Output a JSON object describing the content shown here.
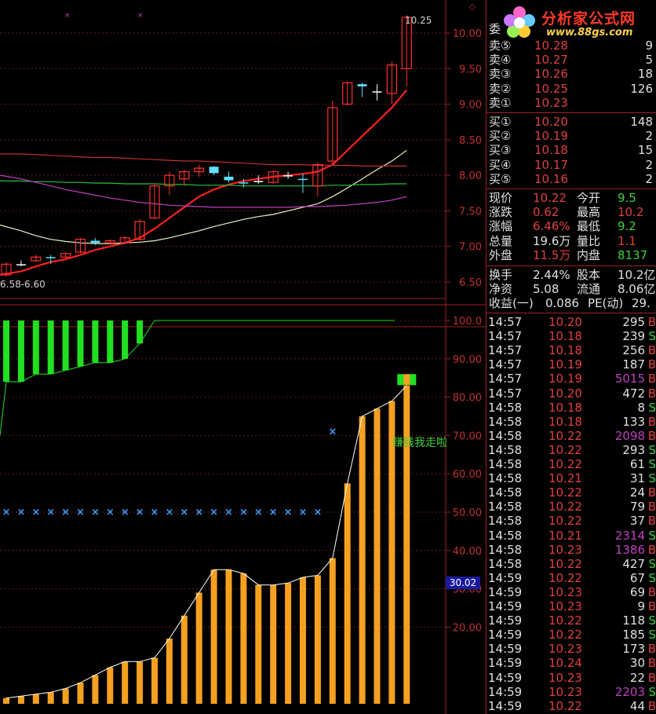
{
  "chart_data": [
    {
      "type": "candlestick",
      "title": "",
      "ylim": [
        6.5,
        10.25
      ],
      "y_ticks": [
        6.5,
        7.0,
        7.5,
        8.0,
        8.5,
        9.0,
        9.5,
        10.0
      ],
      "last_price_label": "10.25",
      "range_label": "6.58-6.60",
      "candles": [
        {
          "o": 6.6,
          "c": 6.75,
          "h": 6.78,
          "l": 6.58,
          "color": "red"
        },
        {
          "o": 6.75,
          "c": 6.75,
          "h": 6.8,
          "l": 6.72,
          "color": "white"
        },
        {
          "o": 6.8,
          "c": 6.85,
          "h": 6.88,
          "l": 6.78,
          "color": "red"
        },
        {
          "o": 6.85,
          "c": 6.85,
          "h": 6.88,
          "l": 6.75,
          "color": "cyan"
        },
        {
          "o": 6.85,
          "c": 6.9,
          "h": 6.92,
          "l": 6.83,
          "color": "red"
        },
        {
          "o": 6.92,
          "c": 7.1,
          "h": 7.12,
          "l": 6.9,
          "color": "red"
        },
        {
          "o": 7.08,
          "c": 7.05,
          "h": 7.12,
          "l": 7.02,
          "color": "cyan"
        },
        {
          "o": 7.05,
          "c": 7.08,
          "h": 7.1,
          "l": 7.02,
          "color": "red"
        },
        {
          "o": 7.05,
          "c": 7.12,
          "h": 7.15,
          "l": 7.03,
          "color": "red"
        },
        {
          "o": 7.1,
          "c": 7.35,
          "h": 7.38,
          "l": 7.08,
          "color": "red"
        },
        {
          "o": 7.4,
          "c": 7.85,
          "h": 7.88,
          "l": 7.38,
          "color": "red"
        },
        {
          "o": 7.85,
          "c": 8.0,
          "h": 8.05,
          "l": 7.72,
          "color": "red"
        },
        {
          "o": 7.95,
          "c": 8.05,
          "h": 8.08,
          "l": 7.85,
          "color": "red"
        },
        {
          "o": 8.05,
          "c": 8.1,
          "h": 8.15,
          "l": 7.98,
          "color": "red"
        },
        {
          "o": 8.12,
          "c": 8.03,
          "h": 8.13,
          "l": 8.0,
          "color": "cyan"
        },
        {
          "o": 7.98,
          "c": 7.93,
          "h": 8.05,
          "l": 7.9,
          "color": "cyan"
        },
        {
          "o": 7.9,
          "c": 7.9,
          "h": 7.95,
          "l": 7.83,
          "color": "cyan"
        },
        {
          "o": 7.92,
          "c": 7.92,
          "h": 8.0,
          "l": 7.88,
          "color": "white"
        },
        {
          "o": 7.9,
          "c": 8.05,
          "h": 8.07,
          "l": 7.88,
          "color": "red"
        },
        {
          "o": 8.0,
          "c": 8.0,
          "h": 8.05,
          "l": 7.95,
          "color": "white"
        },
        {
          "o": 7.95,
          "c": 7.95,
          "h": 8.02,
          "l": 7.75,
          "color": "cyan"
        },
        {
          "o": 7.85,
          "c": 8.15,
          "h": 8.18,
          "l": 7.7,
          "color": "red"
        },
        {
          "o": 8.2,
          "c": 8.95,
          "h": 9.05,
          "l": 8.15,
          "color": "red"
        },
        {
          "o": 9.0,
          "c": 9.3,
          "h": 9.32,
          "l": 8.98,
          "color": "red"
        },
        {
          "o": 9.28,
          "c": 9.25,
          "h": 9.3,
          "l": 9.1,
          "color": "cyan"
        },
        {
          "o": 9.18,
          "c": 9.18,
          "h": 9.28,
          "l": 9.05,
          "color": "white"
        },
        {
          "o": 9.15,
          "c": 9.55,
          "h": 9.6,
          "l": 9.0,
          "color": "red"
        },
        {
          "o": 9.5,
          "c": 10.22,
          "h": 10.25,
          "l": 9.25,
          "color": "red"
        }
      ],
      "ma_series": [
        {
          "color": "#ff2020",
          "values": [
            6.6,
            6.65,
            6.72,
            6.78,
            6.82,
            6.88,
            6.95,
            7.0,
            7.05,
            7.12,
            7.25,
            7.4,
            7.55,
            7.7,
            7.8,
            7.87,
            7.92,
            7.95,
            7.98,
            8.0,
            8.02,
            8.05,
            8.15,
            8.35,
            8.55,
            8.75,
            8.95,
            9.2
          ]
        },
        {
          "color": "#f0f0c0",
          "values": [
            7.3,
            7.22,
            7.15,
            7.1,
            7.07,
            7.05,
            7.04,
            7.04,
            7.05,
            7.06,
            7.08,
            7.12,
            7.17,
            7.22,
            7.28,
            7.33,
            7.38,
            7.42,
            7.45,
            7.5,
            7.55,
            7.6,
            7.7,
            7.82,
            7.95,
            8.08,
            8.2,
            8.35
          ]
        },
        {
          "color": "#20c040",
          "values": [
            7.92,
            7.92,
            7.91,
            7.91,
            7.9,
            7.9,
            7.89,
            7.89,
            7.88,
            7.88,
            7.88,
            7.87,
            7.87,
            7.86,
            7.86,
            7.86,
            7.85,
            7.85,
            7.85,
            7.85,
            7.85,
            7.85,
            7.86,
            7.86,
            7.87,
            7.87,
            7.88,
            7.88
          ]
        },
        {
          "color": "#c040c0",
          "values": [
            8.0,
            7.95,
            7.9,
            7.85,
            7.8,
            7.76,
            7.72,
            7.68,
            7.65,
            7.62,
            7.6,
            7.58,
            7.57,
            7.56,
            7.55,
            7.55,
            7.55,
            7.55,
            7.55,
            7.55,
            7.56,
            7.56,
            7.57,
            7.58,
            7.6,
            7.62,
            7.65,
            7.7
          ]
        },
        {
          "color": "#c03030",
          "values": [
            8.3,
            8.3,
            8.29,
            8.28,
            8.27,
            8.26,
            8.25,
            8.25,
            8.24,
            8.23,
            8.22,
            8.21,
            8.2,
            8.2,
            8.19,
            8.18,
            8.17,
            8.16,
            8.15,
            8.15,
            8.15,
            8.14,
            8.14,
            8.14,
            8.13,
            8.13,
            8.13,
            8.13
          ]
        }
      ]
    },
    {
      "type": "bar",
      "title": "",
      "ylim": [
        0,
        105
      ],
      "y_ticks": [
        20.0,
        30.0,
        40.0,
        50.0,
        60.0,
        70.0,
        80.0,
        90.0,
        100.0
      ],
      "current_value_label": "30.02",
      "annotation": "赚钱我走啦",
      "values": [
        1.5,
        2,
        2.5,
        3,
        4,
        5.5,
        7.5,
        9.5,
        11,
        11,
        12,
        17,
        23,
        29,
        35,
        35,
        34,
        31,
        31,
        31.5,
        33,
        33.5,
        38,
        57.5,
        75,
        77,
        79,
        83
      ],
      "green_bars_top": [
        100,
        100,
        100,
        100,
        100,
        100,
        100,
        100,
        100,
        100
      ],
      "green_bars_bottom": [
        84,
        84,
        86,
        86,
        87,
        88,
        89,
        89,
        90,
        94
      ],
      "marker_level": 50
    }
  ],
  "logo": {
    "name": "分析家公式网",
    "url": "www.88gs.com"
  },
  "panel": {
    "cutoff_label": "委",
    "asks": [
      {
        "label": "卖⑤",
        "price": "10.28",
        "vol": "9"
      },
      {
        "label": "卖④",
        "price": "10.27",
        "vol": "5"
      },
      {
        "label": "卖③",
        "price": "10.26",
        "vol": "18"
      },
      {
        "label": "卖②",
        "price": "10.25",
        "vol": "126"
      },
      {
        "label": "卖①",
        "price": "10.23",
        "vol": ""
      }
    ],
    "bids": [
      {
        "label": "买①",
        "price": "10.20",
        "vol": "148"
      },
      {
        "label": "买②",
        "price": "10.19",
        "vol": "2"
      },
      {
        "label": "买③",
        "price": "10.18",
        "vol": "15"
      },
      {
        "label": "买④",
        "price": "10.17",
        "vol": "2"
      },
      {
        "label": "买⑤",
        "price": "10.16",
        "vol": "2"
      }
    ],
    "stats": [
      {
        "l1": "现价",
        "v1": "10.22",
        "c1": "#e04040",
        "l2": "今开",
        "v2": "9.5",
        "c2": "#40d040"
      },
      {
        "l1": "涨跌",
        "v1": "0.62",
        "c1": "#e04040",
        "l2": "最高",
        "v2": "10.2",
        "c2": "#e04040"
      },
      {
        "l1": "涨幅",
        "v1": "6.46%",
        "c1": "#e04040",
        "l2": "最低",
        "v2": "9.2",
        "c2": "#40d040"
      },
      {
        "l1": "总量",
        "v1": "19.6万",
        "c1": "#e0e0e0",
        "l2": "量比",
        "v2": "1.1",
        "c2": "#e04040"
      },
      {
        "l1": "外盘",
        "v1": "11.5万",
        "c1": "#e04040",
        "l2": "内盘",
        "v2": "8137",
        "c2": "#40d040"
      }
    ],
    "fundamentals": [
      {
        "l1": "换手",
        "v1": "2.44%",
        "l2": "股本",
        "v2": "10.2亿"
      },
      {
        "l1": "净资",
        "v1": "5.08",
        "l2": "流通",
        "v2": "8.06亿"
      },
      {
        "l1": "收益(一)",
        "v1": "0.086",
        "l2": "PE(动)",
        "v2": "29."
      }
    ],
    "trades": [
      {
        "time": "14:57",
        "price": "10.20",
        "vol": "295",
        "flag": "B",
        "vc": "#e0e0e0",
        "fc": "#e04040"
      },
      {
        "time": "14:57",
        "price": "10.18",
        "vol": "239",
        "flag": "S",
        "vc": "#e0e0e0",
        "fc": "#40d040"
      },
      {
        "time": "14:57",
        "price": "10.18",
        "vol": "256",
        "flag": "B",
        "vc": "#e0e0e0",
        "fc": "#e04040"
      },
      {
        "time": "14:57",
        "price": "10.19",
        "vol": "187",
        "flag": "B",
        "vc": "#e0e0e0",
        "fc": "#e04040"
      },
      {
        "time": "14:57",
        "price": "10.19",
        "vol": "5015",
        "flag": "B",
        "vc": "#c040c0",
        "fc": "#e04040"
      },
      {
        "time": "14:57",
        "price": "10.20",
        "vol": "472",
        "flag": "B",
        "vc": "#e0e0e0",
        "fc": "#e04040"
      },
      {
        "time": "14:58",
        "price": "10.18",
        "vol": "8",
        "flag": "S",
        "vc": "#e0e0e0",
        "fc": "#40d040"
      },
      {
        "time": "14:58",
        "price": "10.18",
        "vol": "133",
        "flag": "B",
        "vc": "#e0e0e0",
        "fc": "#e04040"
      },
      {
        "time": "14:58",
        "price": "10.22",
        "vol": "2098",
        "flag": "B",
        "vc": "#c040c0",
        "fc": "#e04040"
      },
      {
        "time": "14:58",
        "price": "10.22",
        "vol": "293",
        "flag": "S",
        "vc": "#e0e0e0",
        "fc": "#40d040"
      },
      {
        "time": "14:58",
        "price": "10.22",
        "vol": "61",
        "flag": "S",
        "vc": "#e0e0e0",
        "fc": "#40d040"
      },
      {
        "time": "14:58",
        "price": "10.21",
        "vol": "31",
        "flag": "S",
        "vc": "#e0e0e0",
        "fc": "#40d040"
      },
      {
        "time": "14:58",
        "price": "10.22",
        "vol": "24",
        "flag": "B",
        "vc": "#e0e0e0",
        "fc": "#e04040"
      },
      {
        "time": "14:58",
        "price": "10.22",
        "vol": "79",
        "flag": "B",
        "vc": "#e0e0e0",
        "fc": "#e04040"
      },
      {
        "time": "14:58",
        "price": "10.22",
        "vol": "37",
        "flag": "B",
        "vc": "#e0e0e0",
        "fc": "#e04040"
      },
      {
        "time": "14:58",
        "price": "10.21",
        "vol": "2314",
        "flag": "S",
        "vc": "#c040c0",
        "fc": "#40d040"
      },
      {
        "time": "14:58",
        "price": "10.23",
        "vol": "1386",
        "flag": "B",
        "vc": "#c040c0",
        "fc": "#e04040"
      },
      {
        "time": "14:58",
        "price": "10.22",
        "vol": "427",
        "flag": "S",
        "vc": "#e0e0e0",
        "fc": "#40d040"
      },
      {
        "time": "14:59",
        "price": "10.22",
        "vol": "67",
        "flag": "S",
        "vc": "#e0e0e0",
        "fc": "#40d040"
      },
      {
        "time": "14:59",
        "price": "10.23",
        "vol": "69",
        "flag": "B",
        "vc": "#e0e0e0",
        "fc": "#e04040"
      },
      {
        "time": "14:59",
        "price": "10.23",
        "vol": "9",
        "flag": "B",
        "vc": "#e0e0e0",
        "fc": "#e04040"
      },
      {
        "time": "14:59",
        "price": "10.22",
        "vol": "118",
        "flag": "S",
        "vc": "#e0e0e0",
        "fc": "#40d040"
      },
      {
        "time": "14:59",
        "price": "10.22",
        "vol": "185",
        "flag": "S",
        "vc": "#e0e0e0",
        "fc": "#40d040"
      },
      {
        "time": "14:59",
        "price": "10.23",
        "vol": "173",
        "flag": "B",
        "vc": "#e0e0e0",
        "fc": "#e04040"
      },
      {
        "time": "14:59",
        "price": "10.24",
        "vol": "30",
        "flag": "B",
        "vc": "#e0e0e0",
        "fc": "#e04040"
      },
      {
        "time": "14:59",
        "price": "10.23",
        "vol": "22",
        "flag": "B",
        "vc": "#e0e0e0",
        "fc": "#e04040"
      },
      {
        "time": "14:59",
        "price": "10.23",
        "vol": "2203",
        "flag": "S",
        "vc": "#c040c0",
        "fc": "#40d040"
      },
      {
        "time": "14:59",
        "price": "10.22",
        "vol": "44",
        "flag": "B",
        "vc": "#e0e0e0",
        "fc": "#e04040"
      }
    ]
  }
}
